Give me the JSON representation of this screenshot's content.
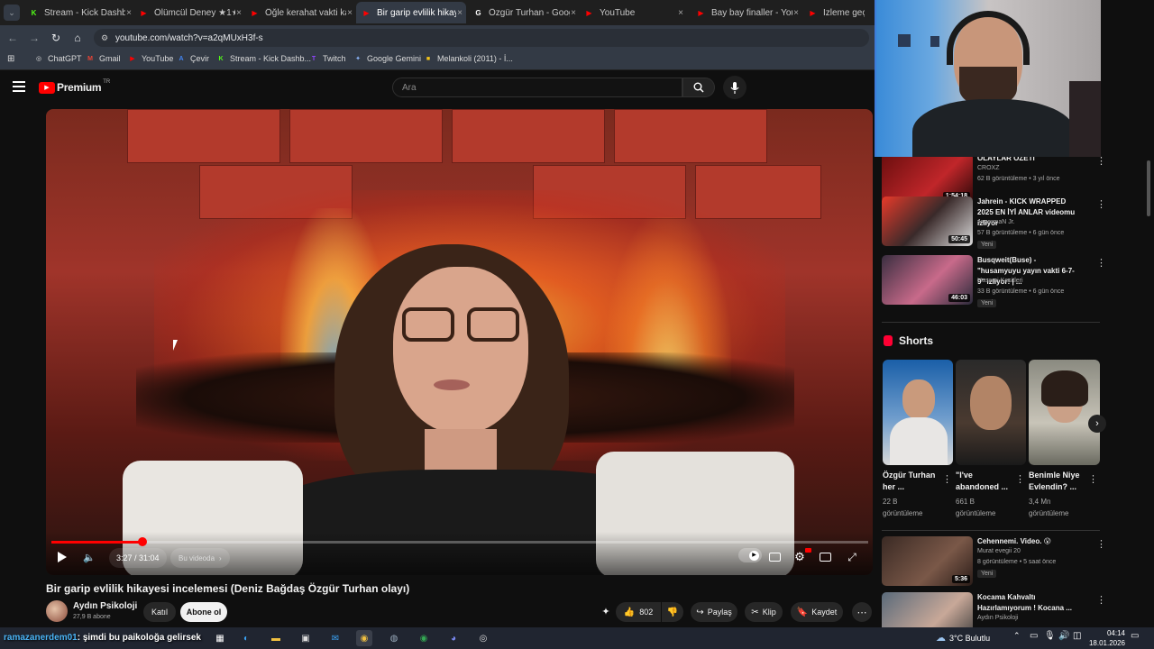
{
  "browser": {
    "tabs": [
      {
        "label": "Stream - Kick Dashb",
        "icon": "K",
        "color": "#53fc18"
      },
      {
        "label": "Ölümcül Deney ★1★",
        "icon": "▶",
        "color": "#ff0000"
      },
      {
        "label": "Öğle kerahat vakti ka",
        "icon": "▶",
        "color": "#ff0000"
      },
      {
        "label": "Bir garip evlilik hikaye",
        "icon": "▶",
        "color": "#ff0000"
      },
      {
        "label": "Özgür Turhan - Goog",
        "icon": "G",
        "color": "#ffffff"
      },
      {
        "label": "YouTube",
        "icon": "▶",
        "color": "#ff0000"
      },
      {
        "label": "Bay bay finaller - You",
        "icon": "▶",
        "color": "#ff0000"
      },
      {
        "label": "İzleme geçmişi -",
        "icon": "▶",
        "color": "#ff0000"
      }
    ],
    "url": "youtube.com/watch?v=a2qMUxH3f-s",
    "bookmarks": [
      {
        "label": "ChatGPT",
        "icon": "◎",
        "color": "#dddddd"
      },
      {
        "label": "Gmail",
        "icon": "M",
        "color": "#ea4335"
      },
      {
        "label": "YouTube",
        "icon": "▶",
        "color": "#ff0000"
      },
      {
        "label": "Çevir",
        "icon": "A",
        "color": "#4285f4"
      },
      {
        "label": "Stream - Kick Dashb...",
        "icon": "K",
        "color": "#53fc18"
      },
      {
        "label": "Twitch",
        "icon": "T",
        "color": "#9146ff"
      },
      {
        "label": "Google Gemini",
        "icon": "✦",
        "color": "#8ab4f8"
      },
      {
        "label": "Melankoli (2011) - İ...",
        "icon": "■",
        "color": "#f5c518"
      }
    ]
  },
  "yt": {
    "logo_text": "Premium",
    "region": "TR",
    "search_placeholder": "Ara",
    "accent": "#ff0000"
  },
  "player": {
    "current_time": "3:27 / 31:04",
    "progress_fraction": 0.111,
    "chapter_label": "Bu videoda"
  },
  "video": {
    "title": "Bir garip evlilik hikayesi incelemesi (Deniz Bağdaş Özgür Turhan olayı)",
    "channel": "Aydın Psikoloji",
    "subscribers": "27,9 B abone",
    "join_label": "Katıl",
    "subscribe_label": "Abone ol",
    "likes": "802",
    "share_label": "Paylaş",
    "clip_label": "Klip",
    "save_label": "Kaydet"
  },
  "recommendations": [
    {
      "title": "OLAYLAR ÖZETİ",
      "channel": "CROXZ",
      "meta": "62 B görüntüleme • 3 yıl önce",
      "duration": "1:54:18",
      "is_new": false
    },
    {
      "title": "Jahrein - KICK WRAPPED 2025 EN İYİ ANLAR videomu izliyor",
      "channel": "JagermaN Jr.",
      "meta": "57 B görüntüleme • 6 gün önce",
      "duration": "50:45",
      "is_new": true,
      "new_label": "Yeni"
    },
    {
      "title": "Busqweit(Buse) - \"husamyuyu yayın vakti 6-7-9\" izliyor! | ...",
      "channel": "Husami Kesitleri",
      "meta": "33 B görüntüleme • 6 gün önce",
      "duration": "46:03",
      "is_new": true,
      "new_label": "Yeni"
    }
  ],
  "shorts": {
    "heading": "Shorts",
    "items": [
      {
        "title": "Özgür Turhan her ...",
        "views": "22 B",
        "views_label": "görüntüleme"
      },
      {
        "title": "\"I've abandoned ...",
        "views": "661 B",
        "views_label": "görüntüleme"
      },
      {
        "title": "Benimle Niye Evlendin? ...",
        "views": "3,4 Mn",
        "views_label": "görüntüleme"
      }
    ]
  },
  "recommendations2": [
    {
      "title": "Cehennemi. Video. 😮",
      "channel": "Murat evegii 20",
      "meta": "8 görüntüleme • 5 saat önce",
      "duration": "5:36",
      "is_new": true,
      "new_label": "Yeni"
    },
    {
      "title": "Kocama Kahvaltı Hazırlamıyorum ! Kocana ...",
      "channel": "Aydın Psikoloji",
      "meta": "",
      "duration": "",
      "is_new": false
    }
  ],
  "taskbar": {
    "overlay_user": "ramazanerdem01",
    "overlay_message": ": şimdi bu paikoloğa gelirsek",
    "weather": "3°C  Bulutlu",
    "time": "04:14",
    "date": "18.01.2026"
  }
}
